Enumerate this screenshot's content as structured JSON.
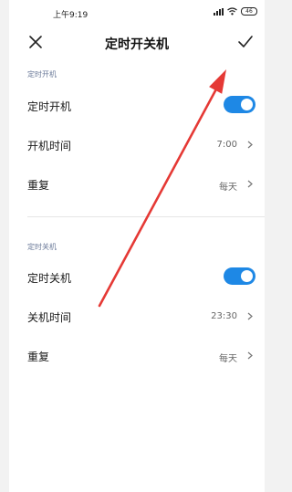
{
  "status_bar": {
    "time": "上午9:19",
    "battery": "46"
  },
  "header": {
    "title": "定时开关机"
  },
  "power_on": {
    "section_label": "定时开机",
    "toggle_label": "定时开机",
    "toggle_on": true,
    "time_label": "开机时间",
    "time_value": "7:00",
    "repeat_label": "重复",
    "repeat_value": "每天"
  },
  "power_off": {
    "section_label": "定时关机",
    "toggle_label": "定时关机",
    "toggle_on": true,
    "time_label": "关机时间",
    "time_value": "23:30",
    "repeat_label": "重复",
    "repeat_value": "每天"
  },
  "colors": {
    "accent": "#1e88e5",
    "annotation_arrow": "#e53935",
    "section_label": "#6b7a99"
  },
  "icons": {
    "close": "close-icon",
    "confirm": "checkmark-icon",
    "chevron": "chevron-right-icon"
  }
}
